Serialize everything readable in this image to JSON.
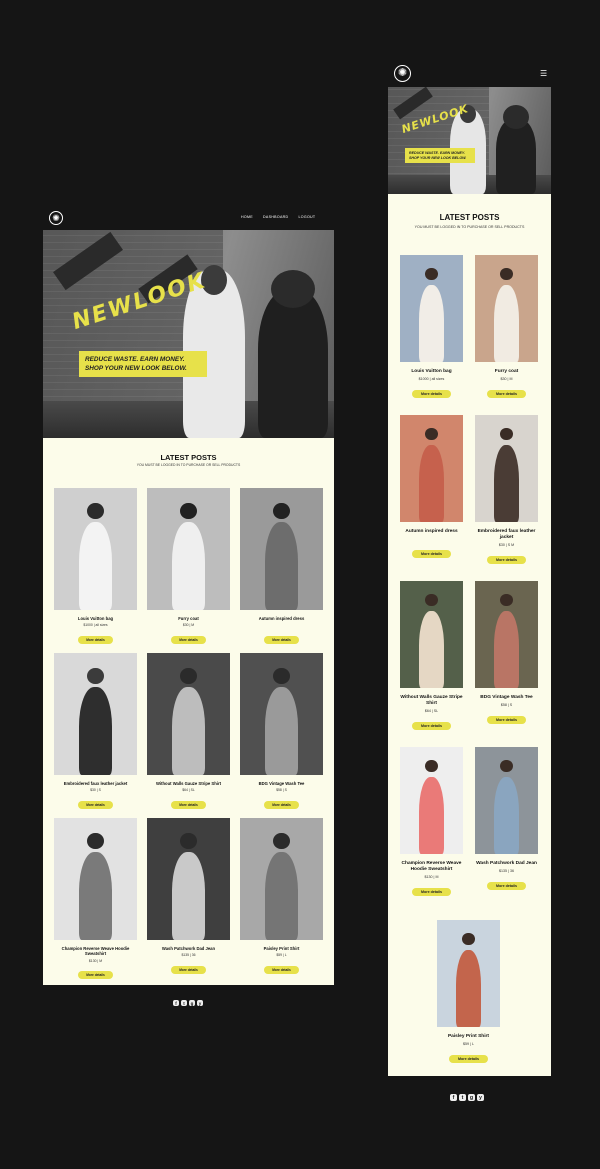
{
  "brand": {
    "wordmark": "NEWLOOK",
    "logo_icon": "sun-icon"
  },
  "nav": {
    "items": [
      "HOME",
      "DASHBOARD",
      "LOGOUT"
    ]
  },
  "hero": {
    "tagline_line1": "REDUCE WASTE. EARN MONEY.",
    "tagline_line2": "SHOP YOUR NEW LOOK BELOW."
  },
  "posts": {
    "title": "LATEST POSTS",
    "subtitle": "YOU MUST BE LOGGED IN TO PURCHASE OR SELL PRODUCTS",
    "button_label": "More details",
    "desktop_items": [
      {
        "name": "Louis Vuitton bag",
        "meta": "$1000 | all sizes"
      },
      {
        "name": "Furry coat",
        "meta": "$30 | M"
      },
      {
        "name": "Autumn inspired dress",
        "meta": ""
      },
      {
        "name": "Embroidered faux leather jacket",
        "meta": "$30 | S"
      },
      {
        "name": "Without Walls Gauze Stripe Shirt",
        "meta": "$64 | SL"
      },
      {
        "name": "BDG Vintage Wash Tee",
        "meta": "$58 | S"
      },
      {
        "name": "Champion Reverse Weave Hoodie Sweatshirt",
        "meta": "$130 | M"
      },
      {
        "name": "Wash Patchwork Dad Jean",
        "meta": "$135 | 36"
      },
      {
        "name": "Paisley Print Shirt",
        "meta": "$59 | L"
      }
    ],
    "mobile_items": [
      {
        "name": "Louis Vuitton bag",
        "meta": "$1000 | all sizes"
      },
      {
        "name": "Furry coat",
        "meta": "$30 | M"
      },
      {
        "name": "Autumn inspired dress",
        "meta": ""
      },
      {
        "name": "Embroidered faux leather jacket",
        "meta": "$30 | S M"
      },
      {
        "name": "Without Walls Gauze Stripe Shirt",
        "meta": "$64 | SL"
      },
      {
        "name": "BDG Vintage Wash Tee",
        "meta": "$58 | S"
      },
      {
        "name": "Champion Reverse Weave Hoodie Sweatshirt",
        "meta": "$130 | M"
      },
      {
        "name": "Wash Patchwork Dad Jean",
        "meta": "$135 | 36"
      },
      {
        "name": "Paisley Print Shirt",
        "meta": "$59 | L"
      }
    ]
  },
  "footer": {
    "social_icons": [
      "f",
      "t",
      "g",
      "y"
    ],
    "icon_names": [
      "facebook-icon",
      "twitter-icon",
      "google-plus-icon",
      "youtube-icon"
    ]
  },
  "colors": {
    "accent": "#e7e14a",
    "page_bg": "#151515",
    "content_bg": "#fcfcea"
  }
}
